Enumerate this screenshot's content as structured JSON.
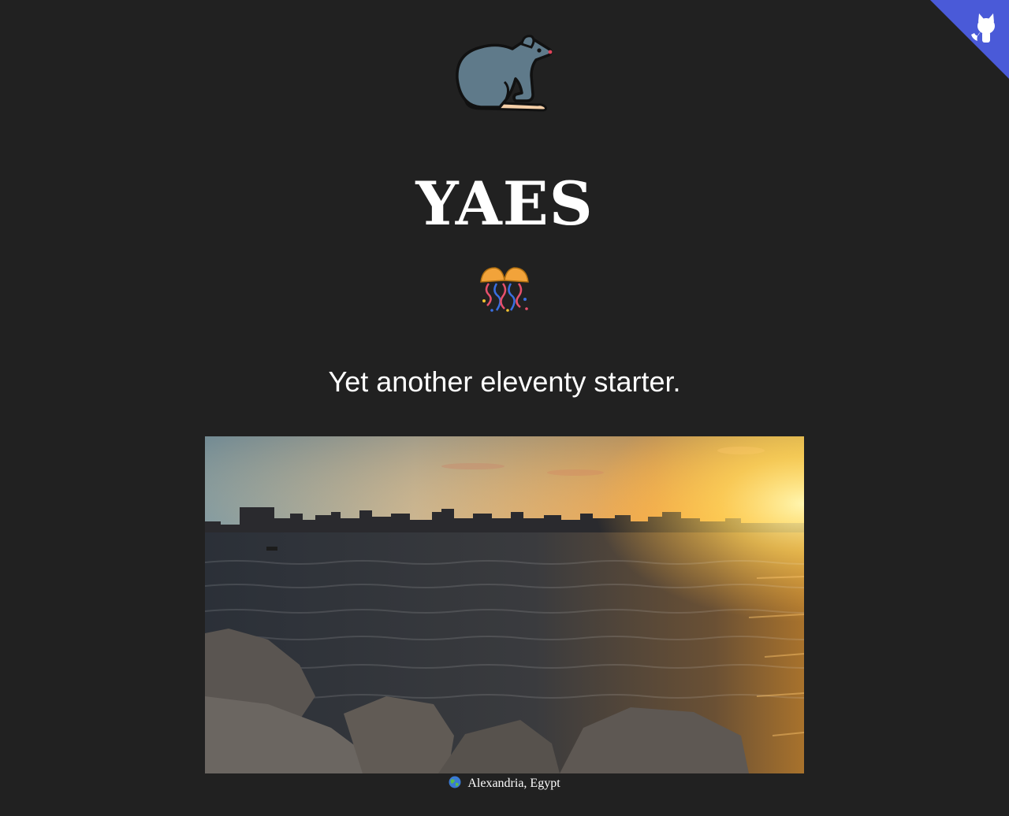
{
  "corner": {
    "icon": "github-octocat-icon",
    "color": "#4a5ad8"
  },
  "logo": {
    "icon": "rat-icon"
  },
  "title": "YAES",
  "celebration": {
    "icon": "confetti-ball-icon"
  },
  "tagline": "Yet another eleventy starter.",
  "hero_image": {
    "subject": "sunset-over-sea-icon"
  },
  "caption": {
    "icon": "globe-icon",
    "text": "Alexandria, Egypt"
  }
}
